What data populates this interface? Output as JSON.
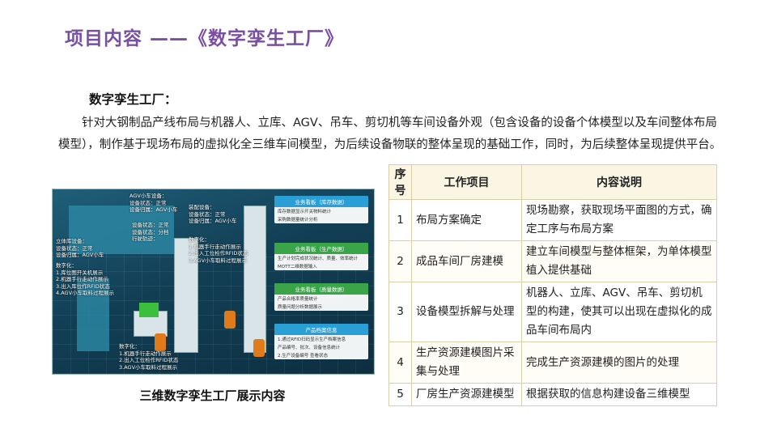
{
  "slide": {
    "title": "项目内容 ——《数字孪生工厂》"
  },
  "section": {
    "heading": "数字孪生工厂：",
    "paragraph": "针对大钢制品产线布局与机器人、立库、AGV、吊车、剪切机等车间设备外观（包含设备的设备个体模型以及车间整体布局模型），制作基于现场布局的虚拟化全三维车间模型，为后续设备物联的整体呈现的基础工作，同时，为后续整体呈现提供平台。"
  },
  "screenshot": {
    "caption": "三维数字孪生工厂展示内容",
    "labels": {
      "agv_top": "AGV小车设备：\n设备状态：正常\n设备归属：AGV小车",
      "left_panel": "立体库设备：\n设备状态：正常\n设备归属：AGV小车",
      "left_func": "数字化：\n1.库位图开关机展示\n2.机器手行走动作展示\n3.出入库位作RFID状态\n4.AGV小车取料过程展示",
      "mid_panel": "装配设备：\n设备状态：正常\n设备归属：AGV小车",
      "mid2_panel": "设备状态：正常\n设备状态：分档\n行驶轨迹：",
      "mid_func": "数字化：\n1.机器手行走动作展示\n2.出入工位检作RFID状态\n3.AGV小车取料过程展示",
      "bottom_panel": "数字化：\n1.机器手行走动作展示\n2.出入工位检作RFID状态\n3.AGV小车取料过程展示"
    },
    "cards": [
      {
        "title": "业务看板（库存数据）",
        "lines": [
          "库存数据显示开关物料统计",
          "采购数据量统计分析"
        ],
        "color": "#2a9fd6"
      },
      {
        "title": "业务看板（生产数据）",
        "lines": [
          "生产计划完成状况统计、质量、效率统计",
          "MOTT二维数据输入"
        ],
        "color": "#3aa548"
      },
      {
        "title": "业务看板（质量数据）",
        "lines": [
          "产品合格率质量统计",
          "质量问题分析数据展示"
        ],
        "color": "#3aa548"
      },
      {
        "title": "产品档案信息",
        "lines": [
          "1.通过RFID扫码显示生产档案信息",
          "产品编号、批次、设备信息统计",
          "2.生产设备编号 查看状态"
        ],
        "color": "#2a9fd6"
      }
    ]
  },
  "table": {
    "headers": [
      "序号",
      "工作项目",
      "内容说明"
    ],
    "rows": [
      {
        "no": "1",
        "item": "布局方案确定",
        "desc": "现场勘察，获取现场平面图的方式，确定工序与布局方案"
      },
      {
        "no": "2",
        "item": "成品车间厂房建模",
        "desc": "建立车间模型与整体框架，为单体模型植入提供基础"
      },
      {
        "no": "3",
        "item": "设备模型拆解与处理",
        "desc": "机器人、立库、AGV、吊车、剪切机型的构建，使其可以出现在虚拟化的成品车间布局内"
      },
      {
        "no": "4",
        "item": "生产资源建模图片采集与处理",
        "desc": "完成生产资源建模的图片的处理"
      },
      {
        "no": "5",
        "item": "厂房生产资源建模型",
        "desc": "根据获取的信息构建设备三维模型"
      }
    ]
  }
}
